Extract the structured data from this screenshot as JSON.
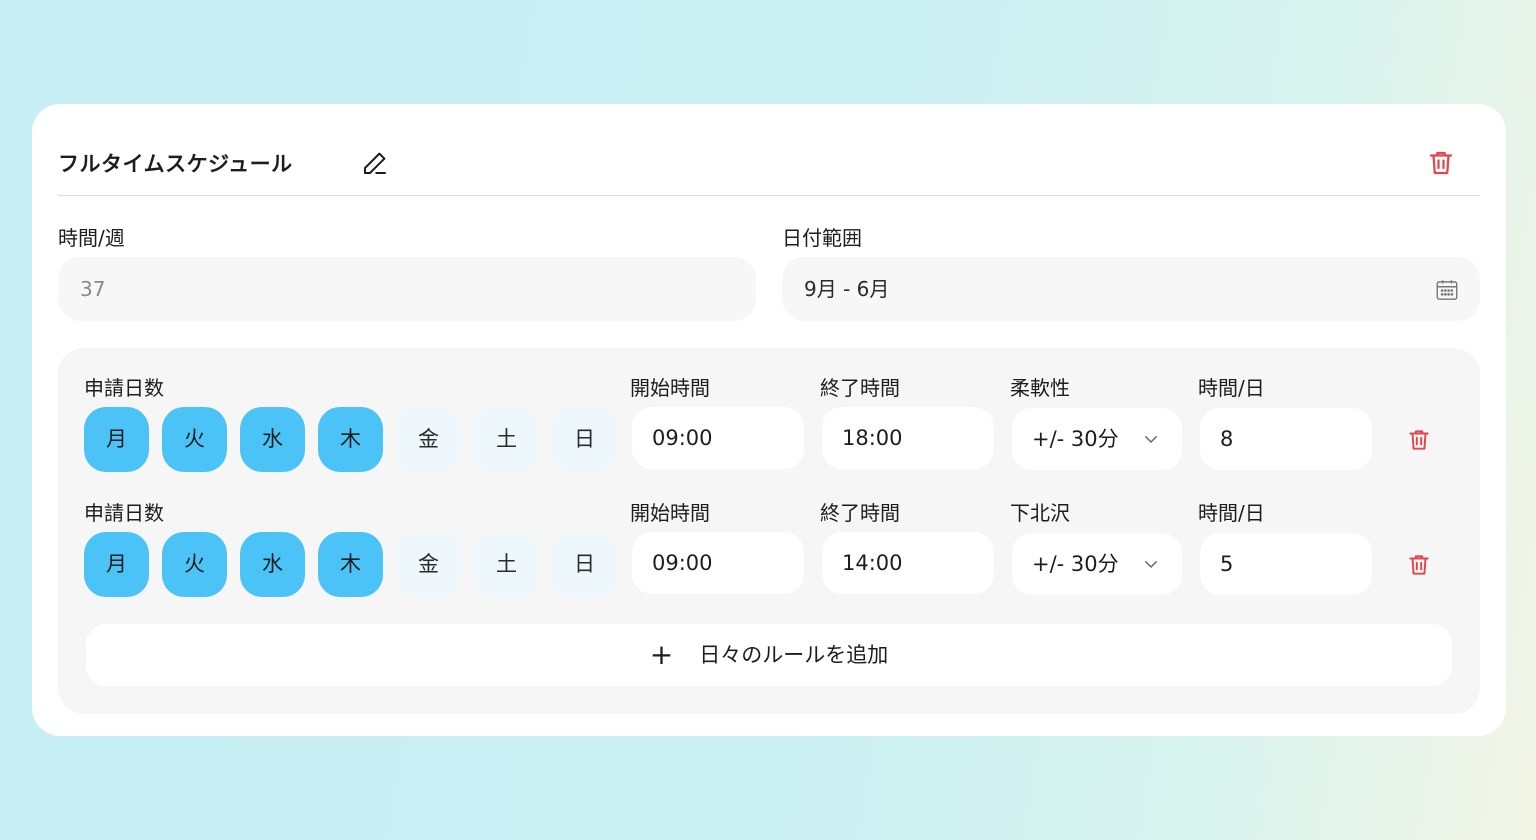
{
  "card": {
    "title": "フルタイムスケジュール",
    "hours_per_week_label": "時間/週",
    "hours_per_week_placeholder": "37",
    "date_range_label": "日付範囲",
    "date_range_value": "9月 - 6月"
  },
  "rules": [
    {
      "days_label": "申請日数",
      "days": [
        {
          "label": "月",
          "on": true
        },
        {
          "label": "火",
          "on": true
        },
        {
          "label": "水",
          "on": true
        },
        {
          "label": "木",
          "on": true
        },
        {
          "label": "金",
          "on": false
        },
        {
          "label": "土",
          "on": false
        },
        {
          "label": "日",
          "on": false
        }
      ],
      "start_label": "開始時間",
      "start_value": "09:00",
      "end_label": "終了時間",
      "end_value": "18:00",
      "flex_label": "柔軟性",
      "flex_value": "+/- 30分",
      "hours_day_label": "時間/日",
      "hours_day_value": "8"
    },
    {
      "days_label": "申請日数",
      "days": [
        {
          "label": "月",
          "on": true
        },
        {
          "label": "火",
          "on": true
        },
        {
          "label": "水",
          "on": true
        },
        {
          "label": "木",
          "on": true
        },
        {
          "label": "金",
          "on": false
        },
        {
          "label": "土",
          "on": false
        },
        {
          "label": "日",
          "on": false
        }
      ],
      "start_label": "開始時間",
      "start_value": "09:00",
      "end_label": "終了時間",
      "end_value": "14:00",
      "flex_label": "下北沢",
      "flex_value": "+/- 30分",
      "hours_day_label": "時間/日",
      "hours_day_value": "5"
    }
  ],
  "add_rule_label": "日々のルールを追加",
  "colors": {
    "accent": "#4cc3f7",
    "danger": "#e0474c",
    "day_off": "#eef7fb"
  }
}
